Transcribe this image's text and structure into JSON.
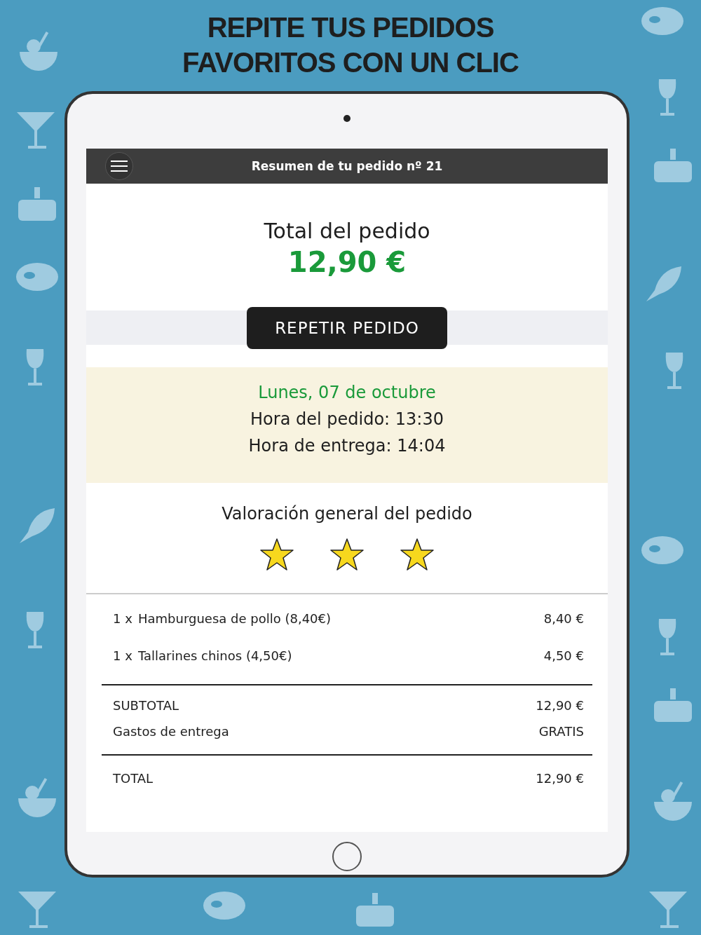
{
  "headline": [
    "REPITE TUS PEDIDOS",
    "FAVORITOS CON UN CLIC"
  ],
  "header": {
    "title": "Resumen de tu pedido nº 21"
  },
  "total": {
    "label": "Total del pedido",
    "amount": "12,90 €"
  },
  "repeat_button": "REPETIR PEDIDO",
  "dates": {
    "day": "Lunes, 07 de octubre",
    "order_time": "Hora del pedido: 13:30",
    "delivery_time": "Hora de entrega: 14:04"
  },
  "rating": {
    "label": "Valoración general del pedido",
    "stars": 3
  },
  "items": [
    {
      "qty": "1 x",
      "name": "Hamburguesa de pollo (8,40€)",
      "price": "8,40 €"
    },
    {
      "qty": "1 x",
      "name": "Tallarines chinos (4,50€)",
      "price": "4,50 €"
    }
  ],
  "summary": [
    {
      "label": "SUBTOTAL",
      "value": "12,90 €"
    },
    {
      "label": "Gastos de entrega",
      "value": "GRATIS"
    }
  ],
  "grand_total": {
    "label": "TOTAL",
    "value": "12,90 €"
  }
}
